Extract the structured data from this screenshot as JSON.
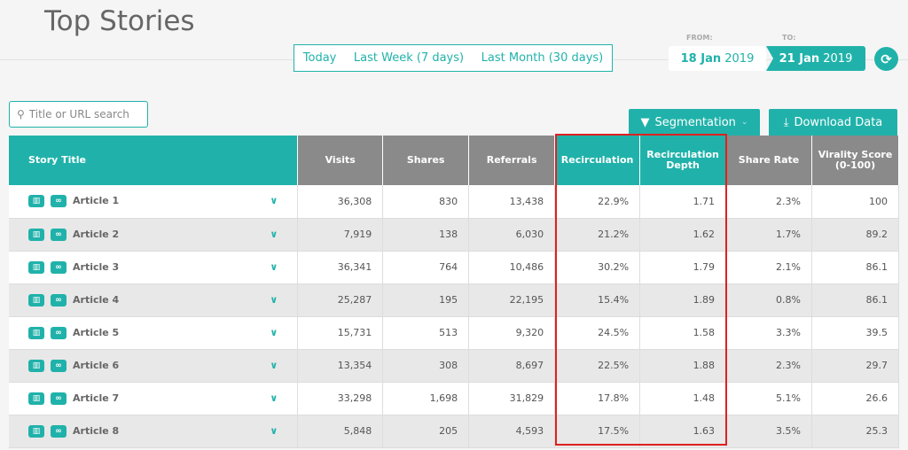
{
  "page": {
    "title": "Top Stories"
  },
  "range": {
    "options": [
      "Today",
      "Last Week (7 days)",
      "Last Month (30 days)"
    ]
  },
  "dates": {
    "from_label": "FROM:",
    "to_label": "TO:",
    "from_day": "18 Jan",
    "from_year": "2019",
    "to_day": "21 Jan",
    "to_year": "2019"
  },
  "search": {
    "placeholder": "Title or URL search"
  },
  "toolbar": {
    "segmentation": "Segmentation",
    "download": "Download Data"
  },
  "colors": {
    "accent": "#20b2aa",
    "header_gray": "#8a8a8a",
    "highlight": "#e02020"
  },
  "table": {
    "headers": [
      "Story Title",
      "Visits",
      "Shares",
      "Referrals",
      "Recirculation",
      "Recirculation Depth",
      "Share Rate",
      "Virality Score (0-100)"
    ],
    "rows": [
      [
        "Article 1",
        "36,308",
        "830",
        "13,438",
        "22.9%",
        "1.71",
        "2.3%",
        "100"
      ],
      [
        "Article 2",
        "7,919",
        "138",
        "6,030",
        "21.2%",
        "1.62",
        "1.7%",
        "89.2"
      ],
      [
        "Article 3",
        "36,341",
        "764",
        "10,486",
        "30.2%",
        "1.79",
        "2.1%",
        "86.1"
      ],
      [
        "Article 4",
        "25,287",
        "195",
        "22,195",
        "15.4%",
        "1.89",
        "0.8%",
        "86.1"
      ],
      [
        "Article 5",
        "15,731",
        "513",
        "9,320",
        "24.5%",
        "1.58",
        "3.3%",
        "39.5"
      ],
      [
        "Article 6",
        "13,354",
        "308",
        "8,697",
        "22.5%",
        "1.88",
        "2.3%",
        "29.7"
      ],
      [
        "Article 7",
        "33,298",
        "1,698",
        "31,829",
        "17.8%",
        "1.48",
        "5.1%",
        "26.6"
      ],
      [
        "Article 8",
        "5,848",
        "205",
        "4,593",
        "17.5%",
        "1.63",
        "3.5%",
        "25.3"
      ]
    ]
  }
}
